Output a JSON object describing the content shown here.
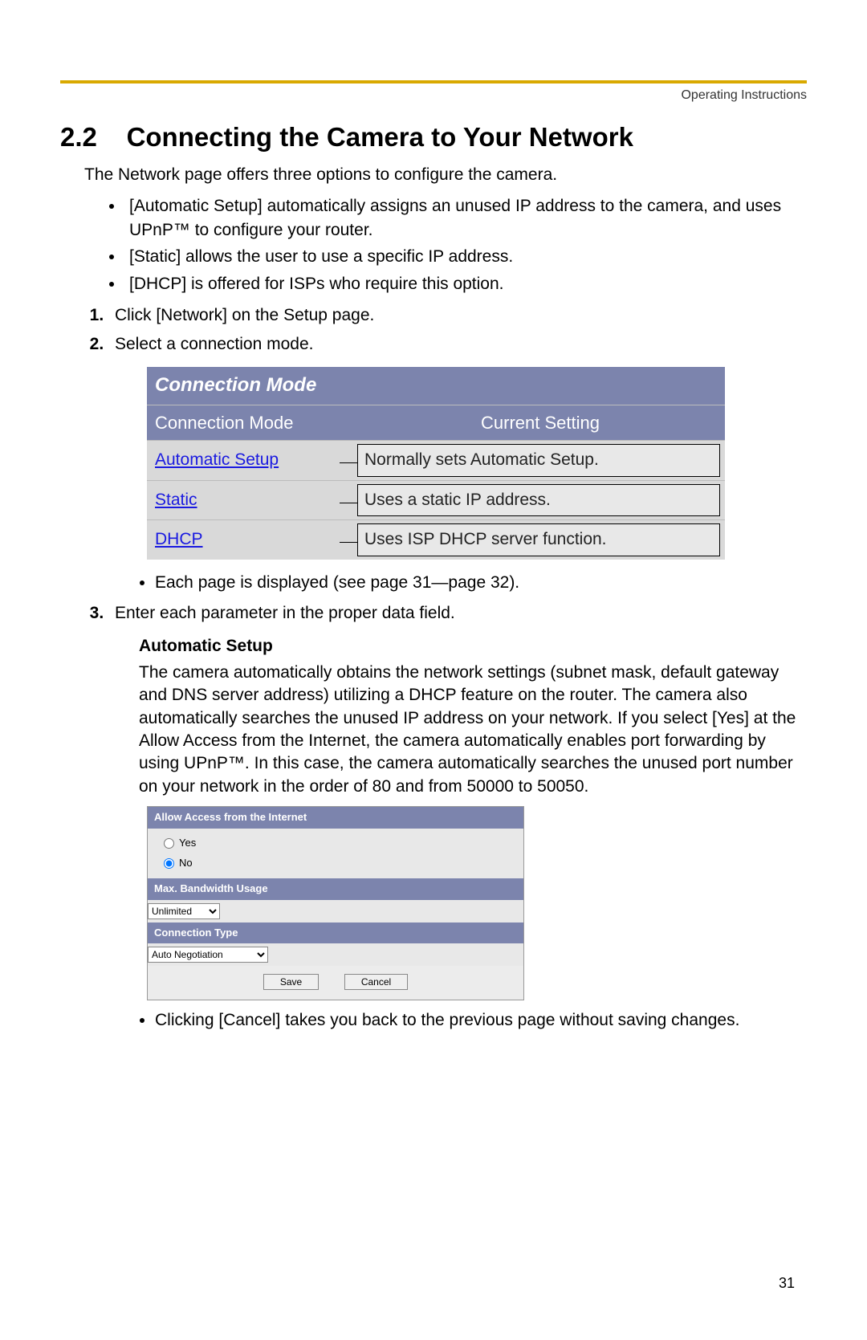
{
  "header": {
    "right_label": "Operating Instructions"
  },
  "section": {
    "number": "2.2",
    "title": "Connecting the Camera to Your Network"
  },
  "intro": "The Network page offers three options to configure the camera.",
  "options": [
    "[Automatic Setup] automatically assigns an unused IP address to the camera, and uses UPnP™ to configure your router.",
    "[Static] allows the user to use a specific IP address.",
    "[DHCP] is offered for ISPs who require this option."
  ],
  "steps": {
    "s1": "Click [Network] on the Setup page.",
    "s2": "Select a connection mode.",
    "s2_note": "Each page is displayed (see page 31—page 32).",
    "s3": "Enter each parameter in the proper data field."
  },
  "conn_table": {
    "title": "Connection Mode",
    "head_left": "Connection Mode",
    "head_right": "Current Setting",
    "rows": [
      {
        "link": "Automatic Setup",
        "desc": "Normally sets Automatic Setup."
      },
      {
        "link": "Static",
        "desc": "Uses a static IP address."
      },
      {
        "link": "DHCP",
        "desc": "Uses ISP DHCP server function."
      }
    ]
  },
  "auto_setup": {
    "heading": "Automatic Setup",
    "paragraph": "The camera automatically obtains the network settings (subnet mask, default gateway and DNS server address) utilizing a DHCP feature on the router. The camera also automatically searches the unused IP address on your network. If you select [Yes] at the Allow Access from the Internet, the camera automatically enables port forwarding by using UPnP™. In this case, the camera automatically searches the unused port number on your network in the order of 80 and from 50000 to 50050."
  },
  "settings": {
    "allow_access_header": "Allow Access from the Internet",
    "yes_label": "Yes",
    "no_label": "No",
    "selected": "No",
    "bandwidth_header": "Max. Bandwidth Usage",
    "bandwidth_value": "Unlimited",
    "conn_type_header": "Connection Type",
    "conn_type_value": "Auto Negotiation",
    "save_label": "Save",
    "cancel_label": "Cancel"
  },
  "cancel_note": "Clicking [Cancel] takes you back to the previous page without saving changes.",
  "page_number": "31"
}
